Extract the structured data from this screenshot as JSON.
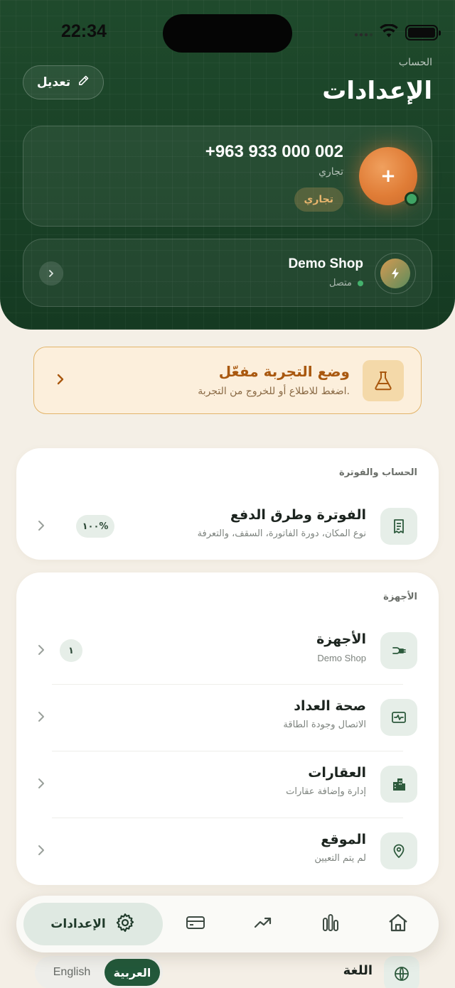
{
  "status_bar": {
    "time": "22:34"
  },
  "header": {
    "edit_label": "تعديل",
    "breadcrumb": "الحساب",
    "title": "الإعدادات"
  },
  "account": {
    "avatar_symbol": "+",
    "phone": "+963 933 000 002",
    "type": "تجاري",
    "badge": "تجاري"
  },
  "shop": {
    "name": "Demo Shop",
    "status": "متصل"
  },
  "demo_mode": {
    "title": "وضع التجربة مفعّل",
    "subtitle": "اضغط للاطلاع أو للخروج من التجربة."
  },
  "billing_section": {
    "title": "الحساب والفوترة",
    "item": {
      "title": "الفوترة وطرق الدفع",
      "subtitle": "نوع المكان، دورة الفاتورة، السقف، والتعرفة",
      "badge": "١٠٠%"
    }
  },
  "devices_section": {
    "title": "الأجهزة",
    "items": [
      {
        "title": "الأجهزة",
        "subtitle": "Demo Shop",
        "badge": "١"
      },
      {
        "title": "صحة العداد",
        "subtitle": "الاتصال وجودة الطاقة"
      },
      {
        "title": "العقارات",
        "subtitle": "إدارة وإضافة عقارات"
      },
      {
        "title": "الموقع",
        "subtitle": "لم يتم التعيين"
      }
    ]
  },
  "bottom_nav": {
    "active_label": "الإعدادات"
  },
  "language": {
    "label": "اللغة",
    "options": [
      "English",
      "العربية"
    ],
    "selected": "العربية"
  },
  "colors": {
    "header_green": "#1a4227",
    "accent_orange": "#e07d37",
    "demo_brown": "#a9580f",
    "active_green": "#22583a"
  }
}
